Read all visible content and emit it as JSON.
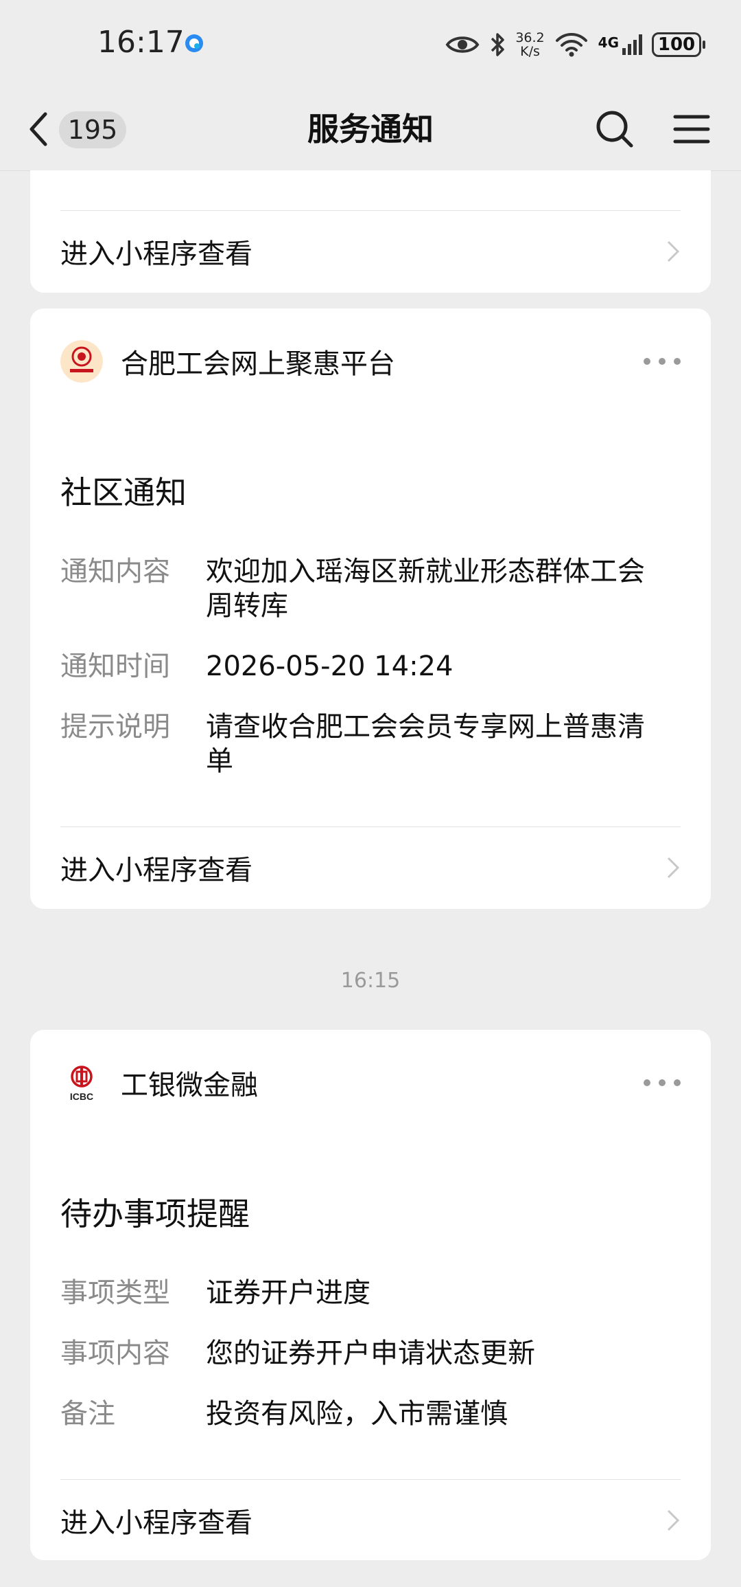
{
  "status_bar": {
    "time": "16:17",
    "net_speed_value": "36.2",
    "net_speed_unit": "K/s",
    "network": "4G",
    "battery": "100"
  },
  "nav": {
    "back_count": "195",
    "title": "服务通知"
  },
  "cards": [
    {
      "link_label": "进入小程序查看"
    },
    {
      "source": "合肥工会网上聚惠平台",
      "title": "社区通知",
      "rows": [
        {
          "key": "通知内容",
          "line1": "欢迎加入瑶海区新就业形态群体工会",
          "line2": "周转库"
        },
        {
          "key": "通知时间",
          "value": "2026-05-20 14:24"
        },
        {
          "key": "提示说明",
          "line1": "请查收合肥工会会员专享网上普惠清",
          "line2": "单"
        }
      ],
      "link_label": "进入小程序查看"
    },
    {
      "source": "工银微金融",
      "title": "待办事项提醒",
      "rows": [
        {
          "key": "事项类型",
          "value": "证券开户进度"
        },
        {
          "key": "事项内容",
          "value": "您的证券开户申请状态更新"
        },
        {
          "key": "备注",
          "value": "投资有风险，入市需谨慎"
        }
      ],
      "link_label": "进入小程序查看"
    }
  ],
  "timestamp": "16:15",
  "icons": {
    "status": [
      "app-notification-icon",
      "eye-icon",
      "bluetooth-icon",
      "wifi-icon",
      "signal-icon",
      "battery-icon"
    ],
    "nav": [
      "back-icon",
      "search-icon",
      "menu-icon"
    ],
    "card": [
      "more-icon",
      "chevron-right-icon"
    ]
  },
  "colors": {
    "background": "#ededed",
    "card": "#ffffff",
    "secondary_text": "#8a8a8a",
    "icbc_red": "#c8151d"
  }
}
